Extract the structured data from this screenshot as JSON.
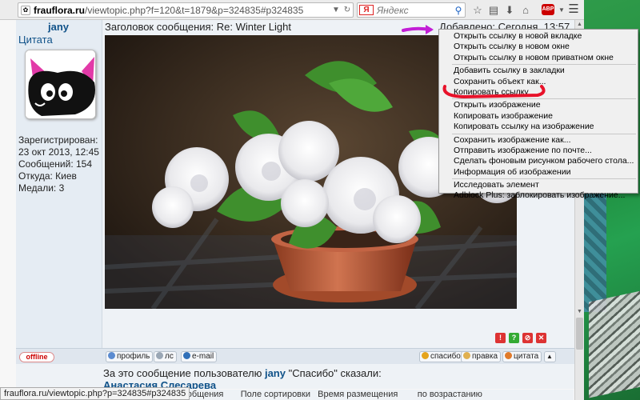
{
  "browser": {
    "url_domain": "frauflora.ru",
    "url_path": "/viewtopic.php?f=120&t=1879&p=324835#p324835",
    "search_placeholder": "Яндекс",
    "search_logo": "Я",
    "abp_label": "ABP"
  },
  "user": {
    "name": "jany",
    "quote_label": "Цитата",
    "info": [
      "Зарегистрирован:",
      "23 окт 2013, 12:45",
      "Сообщений: 154",
      "Откуда: Киев",
      "Медали: 3"
    ]
  },
  "post": {
    "title": "Заголовок сообщения: Re: Winter Light",
    "date": "Добавлено: Сегодня, 13:57"
  },
  "report_icons": [
    {
      "icon": "warning-icon",
      "glyph": "!",
      "color": "#d33"
    },
    {
      "icon": "question-icon",
      "glyph": "?",
      "color": "#3a3"
    },
    {
      "icon": "report-icon",
      "glyph": "⊘",
      "color": "#d33"
    },
    {
      "icon": "delete-icon",
      "glyph": "✕",
      "color": "#d33"
    }
  ],
  "actions": {
    "offline": "offline",
    "profile": "профиль",
    "pm": "лс",
    "email": "e-mail",
    "thanks": "спасибо",
    "edit": "правка",
    "quote": "цитата",
    "top": "▲"
  },
  "thanks_line": {
    "prefix": "За это сообщение пользователю ",
    "user": "jany",
    "suffix": " \"Спасибо\" сказали:",
    "names": "Анастасия Слесарева"
  },
  "sort_row": {
    "text": "сообщения       Поле сортировки   Время размещения        по возрастанию"
  },
  "status_url": "frauflora.ru/viewtopic.php?p=324835#p324835",
  "context_menu": {
    "groups": [
      [
        "Открыть ссылку в новой вкладке",
        "Открыть ссылку в новом окне",
        "Открыть ссылку в новом приватном окне"
      ],
      [
        "Добавить ссылку в закладки",
        "Сохранить объект как...",
        "Копировать ссылку"
      ],
      [
        "Открыть изображение",
        "Копировать изображение",
        "Копировать ссылку на изображение"
      ],
      [
        "Сохранить изображение как...",
        "Отправить изображение по почте...",
        "Сделать фоновым рисунком рабочего стола...",
        "Информация об изображении"
      ],
      [
        "Исследовать элемент",
        "Adblock Plus: заблокировать изображение..."
      ]
    ]
  },
  "colors": {
    "link": "#105289",
    "annotation_red": "#e8122a",
    "annotation_purple": "#c21ed6"
  }
}
